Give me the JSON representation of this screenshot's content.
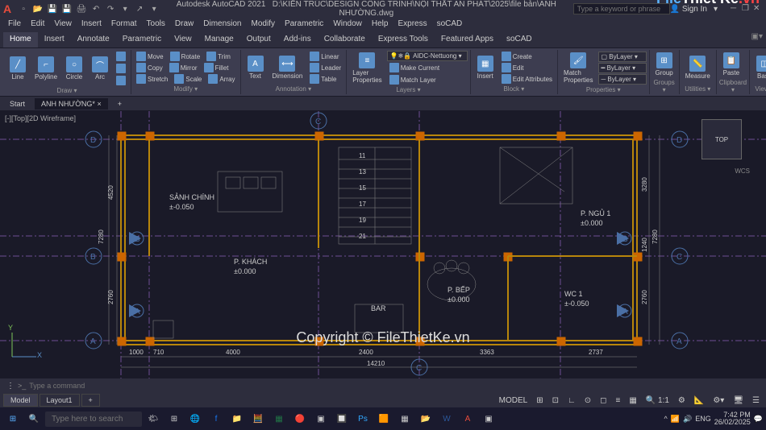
{
  "title": {
    "app": "Autodesk AutoCAD 2021",
    "file": "D:\\KIẾN TRÚC\\DESIGN CÔNG TRÌNH\\NỘI THẤT AN PHÁT\\2025\\file bản\\ANH NHƯỜNG.dwg",
    "search_placeholder": "Type a keyword or phrase",
    "signin": "Sign In"
  },
  "qat": [
    "new",
    "open",
    "save",
    "saveas",
    "plot",
    "undo",
    "redo"
  ],
  "menu": [
    "File",
    "Edit",
    "View",
    "Insert",
    "Format",
    "Tools",
    "Draw",
    "Dimension",
    "Modify",
    "Parametric",
    "Window",
    "Help",
    "Express",
    "soCAD"
  ],
  "ribbon_tabs": [
    "Home",
    "Insert",
    "Annotate",
    "Parametric",
    "View",
    "Manage",
    "Output",
    "Add-ins",
    "Collaborate",
    "Express Tools",
    "Featured Apps",
    "soCAD"
  ],
  "ribbon": {
    "draw": {
      "label": "Draw ▾",
      "line": "Line",
      "polyline": "Polyline",
      "circle": "Circle",
      "arc": "Arc"
    },
    "modify": {
      "label": "Modify ▾",
      "move": "Move",
      "copy": "Copy",
      "stretch": "Stretch",
      "rotate": "Rotate",
      "mirror": "Mirror",
      "scale": "Scale",
      "trim": "Trim",
      "fillet": "Fillet",
      "array": "Array"
    },
    "annotation": {
      "label": "Annotation ▾",
      "text": "Text",
      "dimension": "Dimension",
      "linear": "Linear",
      "leader": "Leader",
      "table": "Table"
    },
    "layers": {
      "label": "Layers ▾",
      "properties": "Layer\nProperties",
      "make_current": "Make Current",
      "match": "Match Layer",
      "aidc": "AIDC-Nettuong"
    },
    "block": {
      "label": "Block ▾",
      "insert": "Insert",
      "create": "Create",
      "edit": "Edit",
      "edit_attr": "Edit Attributes"
    },
    "properties": {
      "label": "Properties ▾",
      "match": "Match\nProperties",
      "bylayer1": "ByLayer",
      "bylayer2": "ByLayer",
      "bylayer3": "ByLayer"
    },
    "groups": {
      "label": "Groups ▾",
      "group": "Group"
    },
    "utilities": {
      "label": "Utilities ▾",
      "measure": "Measure"
    },
    "clipboard": {
      "label": "Clipboard ▾",
      "paste": "Paste"
    },
    "view": {
      "label": "View ▾",
      "base": "Base"
    }
  },
  "filetabs": {
    "start": "Start",
    "active": "ANH NHƯỜNG*",
    "plus": "+"
  },
  "viewport": {
    "label": "[-][Top][2D Wireframe]"
  },
  "rooms": {
    "sanh": "SẢNH CHÍNH",
    "sanh_lvl": "±-0.050",
    "khach": "P. KHÁCH",
    "khach_lvl": "±0.000",
    "bar": "BAR",
    "bep": "P. BẾP",
    "bep_lvl": "±0.000",
    "ngu": "P. NGỦ 1",
    "ngu_lvl": "±0.000",
    "wc": "WC 1",
    "wc_lvl": "±-0.050"
  },
  "dims": {
    "d1000": "1000",
    "d710": "710",
    "d4000": "4000",
    "d2400": "2400",
    "d3363": "3363",
    "d2737": "2737",
    "d14210": "14210",
    "d7280": "7280",
    "d4520": "4520",
    "d2760": "2760",
    "d3280": "3280",
    "d1240": "1240",
    "s11": "11",
    "s13": "13",
    "s15": "15",
    "s17": "17",
    "s19": "19",
    "s21": "21"
  },
  "grids": {
    "a": "A",
    "b": "B",
    "c": "C",
    "d": "D"
  },
  "viewcube": {
    "top": "TOP",
    "wcs": "WCS"
  },
  "ucs": {
    "x": "X",
    "y": "Y"
  },
  "cmd": {
    "prompt": ">_",
    "placeholder": "Type a command"
  },
  "layouts": {
    "model": "Model",
    "layout1": "Layout1",
    "plus": "+"
  },
  "status": {
    "model": "MODEL",
    "lang": "ENG"
  },
  "taskbar": {
    "search_placeholder": "Type here to search",
    "time": "7:42 PM",
    "date": "26/02/2025"
  },
  "watermark": {
    "copy": "Copyright © FileThietKe.vn",
    "logo1": "File",
    "logo2": "Thiết Kế",
    "logo3": ".vn"
  }
}
